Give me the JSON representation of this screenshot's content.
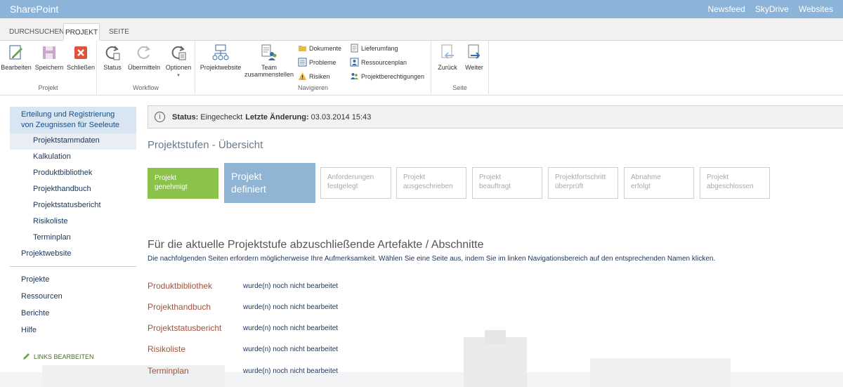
{
  "topbar": {
    "brand": "SharePoint",
    "links": [
      "Newsfeed",
      "SkyDrive",
      "Websites"
    ]
  },
  "ribbon": {
    "tabs": [
      "DURCHSUCHEN",
      "PROJEKT",
      "SEITE"
    ],
    "active_tab": "PROJEKT",
    "groups": {
      "projekt": {
        "label": "Projekt",
        "buttons": [
          "Bearbeiten",
          "Speichern",
          "Schließen"
        ]
      },
      "workflow": {
        "label": "Workflow",
        "buttons": [
          "Status",
          "Übermitteln",
          "Optionen"
        ]
      },
      "navigieren": {
        "label": "Navigieren",
        "big": [
          "Projektwebsite",
          "Team zusammenstellen"
        ],
        "small": [
          "Dokumente",
          "Probleme",
          "Risiken",
          "Lieferumfang",
          "Ressourcenplan",
          "Projektberechtigungen"
        ]
      },
      "seite": {
        "label": "Seite",
        "buttons": [
          "Zurück",
          "Weiter"
        ]
      }
    }
  },
  "leftnav": {
    "project_title": "Erteilung und Registrierung von Zeugnissen für Seeleute",
    "sub_items": [
      "Projektstammdaten",
      "Kalkulation",
      "Produktbibliothek",
      "Projekthandbuch",
      "Projektstatusbericht",
      "Risikoliste",
      "Terminplan"
    ],
    "selected_sub": "Projektstammdaten",
    "website": "Projektwebsite",
    "main_items": [
      "Projekte",
      "Ressourcen",
      "Berichte",
      "Hilfe"
    ],
    "edit_links": "LINKS BEARBEITEN"
  },
  "status": {
    "status_label": "Status:",
    "status_value": "Eingecheckt",
    "changed_label": "Letzte Änderung:",
    "changed_value": "03.03.2014 15:43"
  },
  "stages": {
    "heading": "Projektstufen - Übersicht",
    "items": [
      {
        "label": "Projekt genehmigt",
        "state": "done"
      },
      {
        "label": "Projekt definiert",
        "state": "current"
      },
      {
        "label": "Anforderungen festgelegt",
        "state": "pending"
      },
      {
        "label": "Projekt ausgeschrieben",
        "state": "pending"
      },
      {
        "label": "Projekt beauftragt",
        "state": "pending"
      },
      {
        "label": "Projektfortschritt überprüft",
        "state": "pending"
      },
      {
        "label": "Abnahme erfolgt",
        "state": "pending"
      },
      {
        "label": "Projekt abgeschlossen",
        "state": "pending"
      }
    ]
  },
  "artifacts": {
    "heading": "Für die aktuelle Projektstufe abzuschließende Artefakte / Abschnitte",
    "description": "Die nachfolgenden Seiten erfordern möglicherweise Ihre Aufmerksamkeit. Wählen Sie eine Seite aus, indem Sie im linken Navigationsbereich auf den entsprechenden Namen klicken.",
    "rows": [
      {
        "name": "Produktbibliothek",
        "status": "wurde(n) noch nicht bearbeitet"
      },
      {
        "name": "Projekthandbuch",
        "status": "wurde(n) noch nicht bearbeitet"
      },
      {
        "name": "Projektstatusbericht",
        "status": "wurde(n) noch nicht bearbeitet"
      },
      {
        "name": "Risikoliste",
        "status": "wurde(n) noch nicht bearbeitet"
      },
      {
        "name": "Terminplan",
        "status": "wurde(n) noch nicht bearbeitet"
      }
    ]
  },
  "colors": {
    "topbar": "#8cb4d8",
    "stage_done": "#8bc34a",
    "stage_current": "#8fb4d4",
    "artifact_link": "#a2523a"
  }
}
